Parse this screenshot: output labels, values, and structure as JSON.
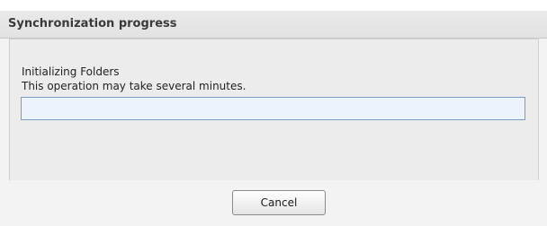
{
  "dialog": {
    "title": "Synchronization progress",
    "status_line_1": "Initializing Folders",
    "status_line_2": "This operation may take several minutes.",
    "progress_fraction": 0,
    "cancel_label": "Cancel"
  },
  "colors": {
    "progress_border": "#7b9cc8",
    "progress_track": "#edf3fb",
    "panel_bg": "#ececec",
    "title_bar_bg": "#e6e6e6"
  }
}
